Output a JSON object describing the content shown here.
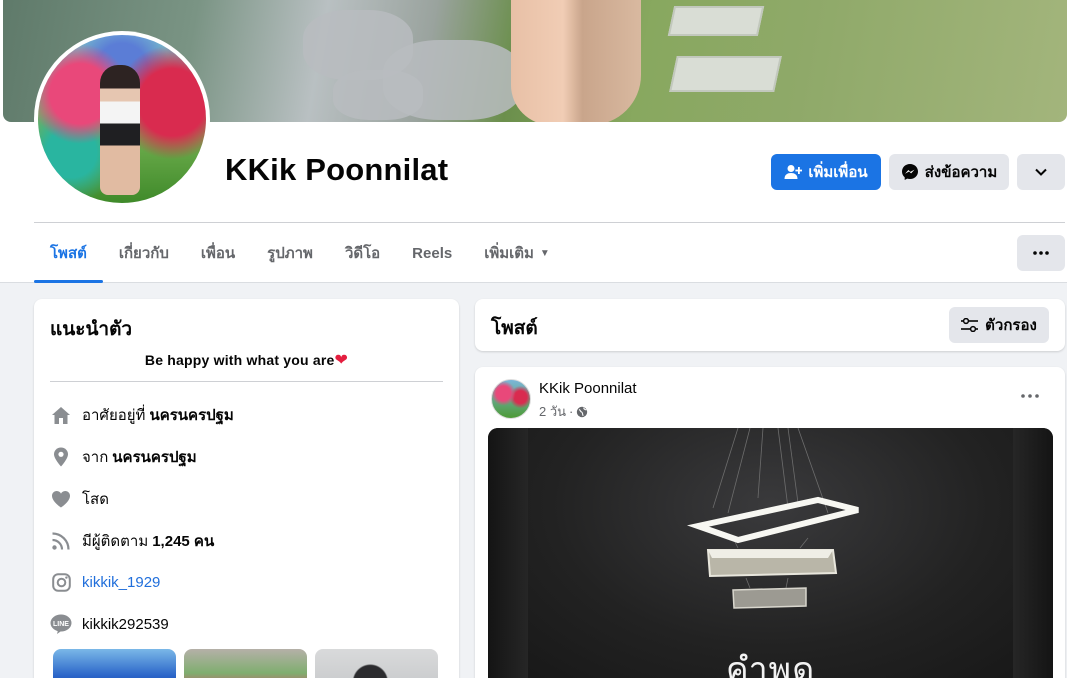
{
  "profile": {
    "name": "KKik Poonnilat",
    "add_friend_label": "เพิ่มเพื่อน",
    "message_label": "ส่งข้อความ"
  },
  "tabs": [
    {
      "label": "โพสต์",
      "active": true
    },
    {
      "label": "เกี่ยวกับ",
      "active": false
    },
    {
      "label": "เพื่อน",
      "active": false
    },
    {
      "label": "รูปภาพ",
      "active": false
    },
    {
      "label": "วิดีโอ",
      "active": false
    },
    {
      "label": "Reels",
      "active": false
    },
    {
      "label": "เพิ่มเติม",
      "active": false
    }
  ],
  "intro": {
    "title": "แนะนำตัว",
    "bio": "Be happy with what you are",
    "lives_in_prefix": "อาศัยอยู่ที่",
    "lives_in_value": "นครนครปฐม",
    "from_prefix": "จาก",
    "from_value": "นครนครปฐม",
    "relationship": "โสด",
    "followers_prefix": "มีผู้ติดตาม",
    "followers_value": "1,245 คน",
    "instagram": "kikkik_1929",
    "line_id": "kikkik292539"
  },
  "posts_section": {
    "title": "โพสต์",
    "filter_label": "ตัวกรอง"
  },
  "post": {
    "author": "KKik Poonnilat",
    "time": "2 วัน",
    "image_text": "คำพูด"
  },
  "colors": {
    "accent": "#1b74e4",
    "background": "#f0f2f5",
    "secondary_button": "#e4e6eb",
    "heart": "#e41e3f"
  }
}
